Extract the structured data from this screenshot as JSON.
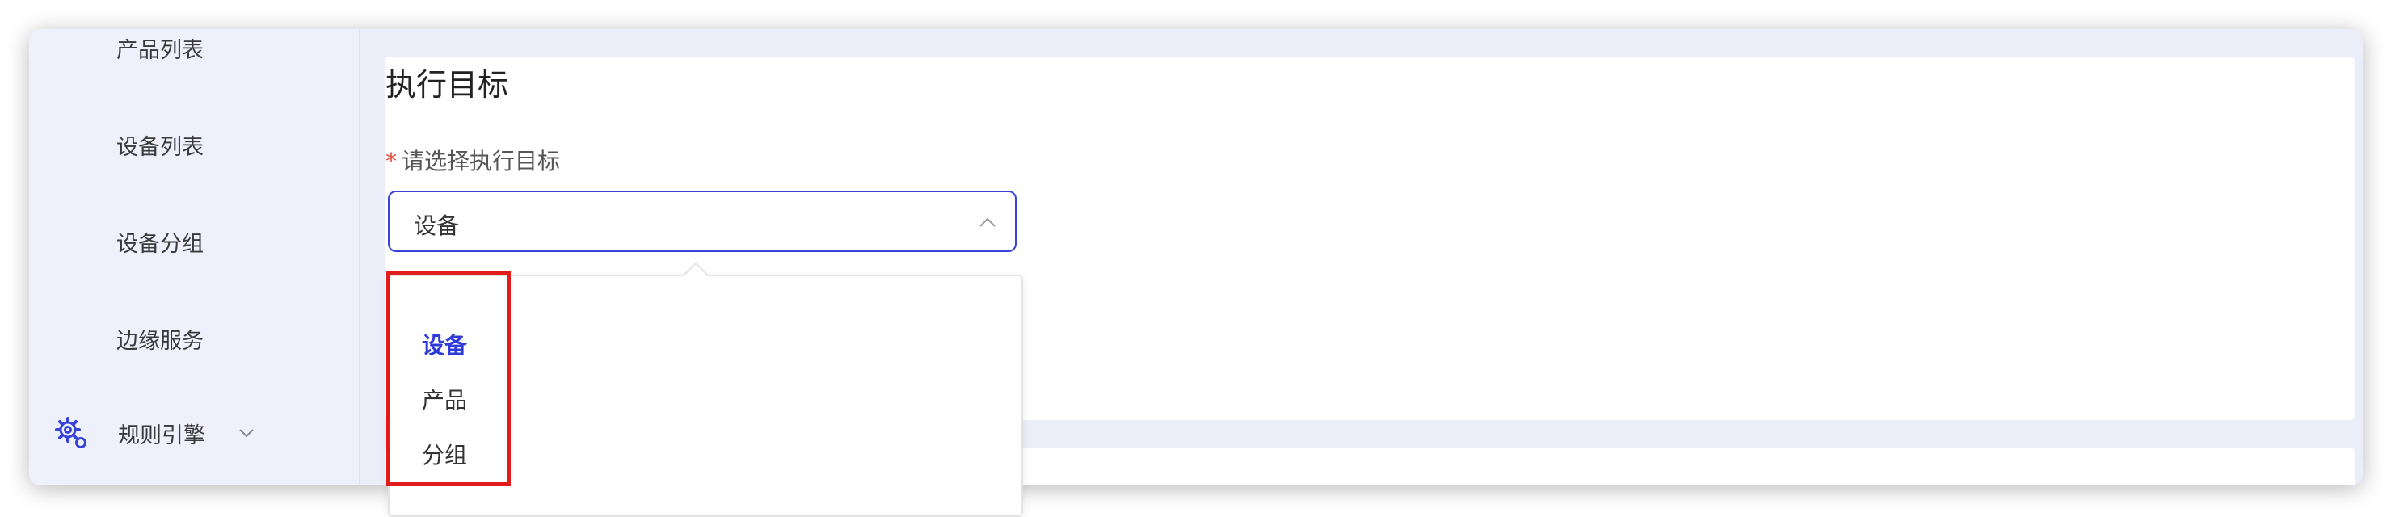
{
  "sidebar": {
    "items": [
      {
        "label": "产品列表"
      },
      {
        "label": "设备列表"
      },
      {
        "label": "设备分组"
      },
      {
        "label": "边缘服务"
      }
    ],
    "group": {
      "label": "规则引擎",
      "icon": "gear-icon"
    }
  },
  "main": {
    "section_title": "执行目标",
    "field": {
      "required_mark": "*",
      "label": "请选择执行目标",
      "value": "设备"
    },
    "dropdown": {
      "options": [
        {
          "label": "设备",
          "selected": true
        },
        {
          "label": "产品",
          "selected": false
        },
        {
          "label": "分组",
          "selected": false
        }
      ]
    }
  },
  "colors": {
    "accent": "#2f3bd6",
    "highlight": "#e21b1b",
    "required": "#e5483c",
    "sidebar_bg": "#eef0fc",
    "content_bg": "#ebedf8"
  }
}
